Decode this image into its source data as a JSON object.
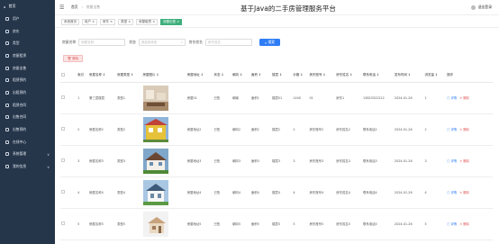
{
  "sidebar": {
    "logo_label": "首页",
    "items": [
      {
        "label": "用户",
        "icon": "user-icon"
      },
      {
        "label": "房东",
        "icon": "landlord-icon"
      },
      {
        "label": "类型",
        "icon": "category-icon"
      },
      {
        "label": "房屋租赁",
        "icon": "house-icon"
      },
      {
        "label": "房屋出售",
        "icon": "sale-icon"
      },
      {
        "label": "租赁预约",
        "icon": "calendar-icon"
      },
      {
        "label": "出租预约",
        "icon": "booking-icon"
      },
      {
        "label": "租赁合同",
        "icon": "contract-icon"
      },
      {
        "label": "出售合同",
        "icon": "document-icon"
      },
      {
        "label": "出售预约",
        "icon": "clock-icon"
      },
      {
        "label": "在线中心",
        "icon": "chat-icon"
      },
      {
        "label": "系统管理",
        "icon": "settings-icon",
        "chevron": "∨"
      },
      {
        "label": "我的信息",
        "icon": "profile-icon",
        "chevron": "∨"
      }
    ]
  },
  "topbar": {
    "crumb_home": "首页",
    "crumb_current": "房屋出售",
    "site_title": "基于Java的二手房管理服务平台",
    "user_label": "退出登录"
  },
  "tags": [
    {
      "label": "系统首页",
      "active": false
    },
    {
      "label": "用户 ×",
      "active": false
    },
    {
      "label": "房东 ×",
      "active": false
    },
    {
      "label": "类型 ×",
      "active": false
    },
    {
      "label": "房屋租赁 ×",
      "active": false
    },
    {
      "label": "房屋出售 ×",
      "active": true
    }
  ],
  "filters": {
    "field1_label": "房屋名称",
    "field1_placeholder": "房屋名称",
    "field2_label": "状态",
    "field2_placeholder": "请选择状态",
    "field3_label": "房东姓名",
    "field3_placeholder": "房东姓名",
    "search_label": "搜索"
  },
  "delete_button_label": "删除",
  "table": {
    "columns": [
      "",
      "索引",
      "房屋名称 ↕",
      "房屋类型 ↕",
      "房屋图片 ↕",
      "房屋地址 ↕",
      "状态 ↕",
      "朝向 ↕",
      "面积 ↕",
      "楼层 ↕",
      "价格 ↕",
      "房东账号 ↕",
      "房东姓名 ↕",
      "联系电话 ↕",
      "发布时间 ↕",
      "浏览量 ↕",
      "操作"
    ],
    "rows": [
      {
        "cells": [
          "1",
          "第三层楼层",
          "类型1",
          "",
          "房屋01",
          "已售",
          "朝南",
          "面积1",
          "楼层01",
          "1400",
          "01",
          "房东1",
          "13823322222",
          "2024-01-26",
          "1"
        ],
        "img": "house-a"
      },
      {
        "cells": [
          "2",
          "房屋名称2",
          "类型2",
          "",
          "房屋地址2",
          "已售",
          "朝向2",
          "面积2",
          "楼层2",
          "2",
          "房东账号2",
          "房东姓名2",
          "联系电话2",
          "2024-01-26",
          "2"
        ],
        "img": "house-b"
      },
      {
        "cells": [
          "3",
          "房屋名称3",
          "类型3",
          "",
          "房屋地址3",
          "已售",
          "朝向3",
          "面积3",
          "楼层3",
          "3",
          "房东账号3",
          "房东姓名3",
          "联系电话3",
          "2024-01-26",
          "3"
        ],
        "img": "house-c"
      },
      {
        "cells": [
          "4",
          "房屋名称4",
          "类型4",
          "",
          "房屋地址4",
          "已售",
          "朝向4",
          "面积4",
          "楼层4",
          "4",
          "房东账号4",
          "房东姓名4",
          "联系电话4",
          "2024-01-26",
          "4"
        ],
        "img": "house-d"
      },
      {
        "cells": [
          "5",
          "房屋名称5",
          "类型5",
          "",
          "房屋地址5",
          "已售",
          "朝向5",
          "面积5",
          "楼层5",
          "5",
          "房东账号5",
          "房东姓名5",
          "联系电话5",
          "2024-01-26",
          "5"
        ],
        "img": "house-e"
      }
    ],
    "edit_label": "详情",
    "delete_label": "删除"
  }
}
